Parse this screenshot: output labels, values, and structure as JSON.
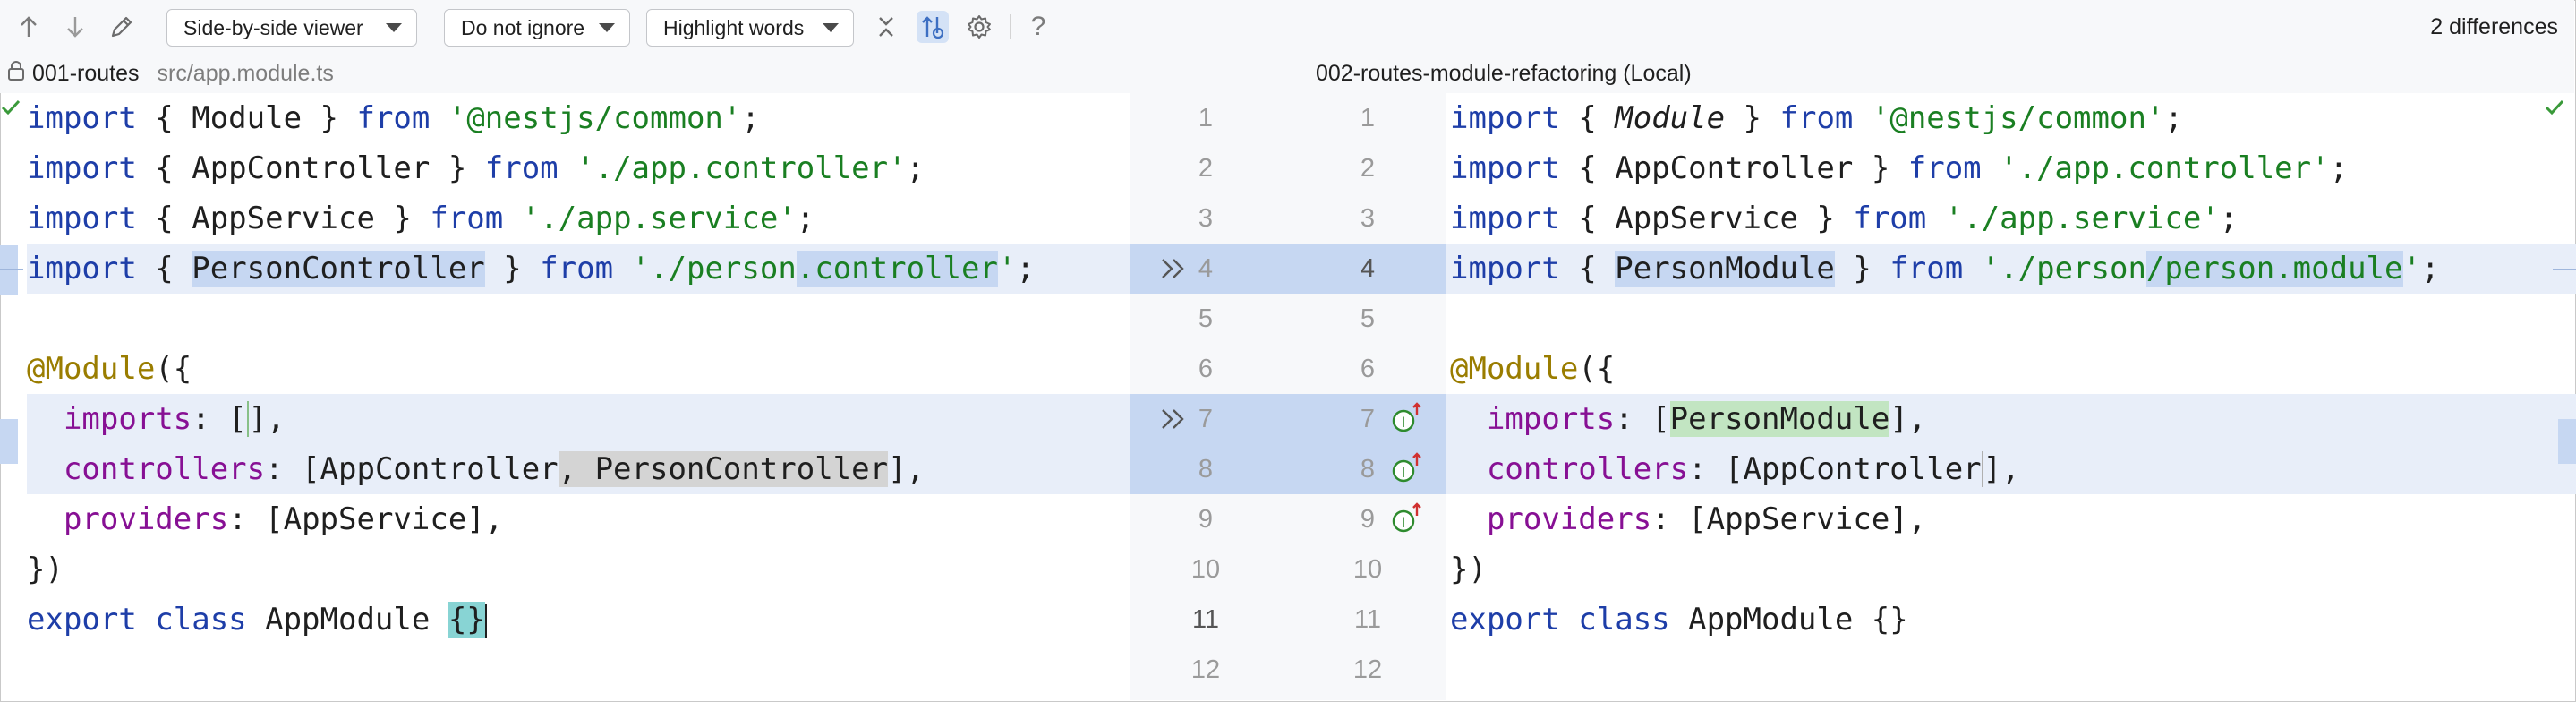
{
  "toolbar": {
    "icons": [
      "arrow-up-icon",
      "arrow-down-icon",
      "edit-icon"
    ],
    "viewer_select": "Side-by-side viewer",
    "ignore_select": "Do not ignore",
    "highlight_select": "Highlight words",
    "extra_icons": [
      "collapse-icon",
      "sync-scroll-icon",
      "settings-icon",
      "help-icon"
    ],
    "help_glyph": "?",
    "differences": "2 differences"
  },
  "left_header": {
    "branch": "001-routes",
    "path": "src/app.module.ts"
  },
  "right_header": {
    "title": "002-routes-module-refactoring (Local)"
  },
  "left_lines": [
    "import { Module } from '@nestjs/common';",
    "import { AppController } from './app.controller';",
    "import { AppService } from './app.service';",
    "import { PersonController } from './person.controller';",
    "",
    "@Module({",
    "  imports: [],",
    "  controllers: [AppController, PersonController],",
    "  providers: [AppService],",
    "})",
    "export class AppModule {}",
    ""
  ],
  "right_lines": [
    "import { Module } from '@nestjs/common';",
    "import { AppController } from './app.controller';",
    "import { AppService } from './app.service';",
    "import { PersonModule } from './person/person.module';",
    "",
    "@Module({",
    "  imports: [PersonModule],",
    "  controllers: [AppController],",
    "  providers: [AppService],",
    "})",
    "export class AppModule {}",
    ""
  ],
  "line_numbers": [
    "1",
    "2",
    "3",
    "4",
    "5",
    "6",
    "7",
    "8",
    "9",
    "10",
    "11",
    "12"
  ],
  "colors": {
    "change_bg": "#e8eef9",
    "word_hl": "#c6d7f2",
    "gutter_block": "#c6d7f2",
    "added": "#c2e5c2",
    "removed": "#d4d4d4"
  }
}
